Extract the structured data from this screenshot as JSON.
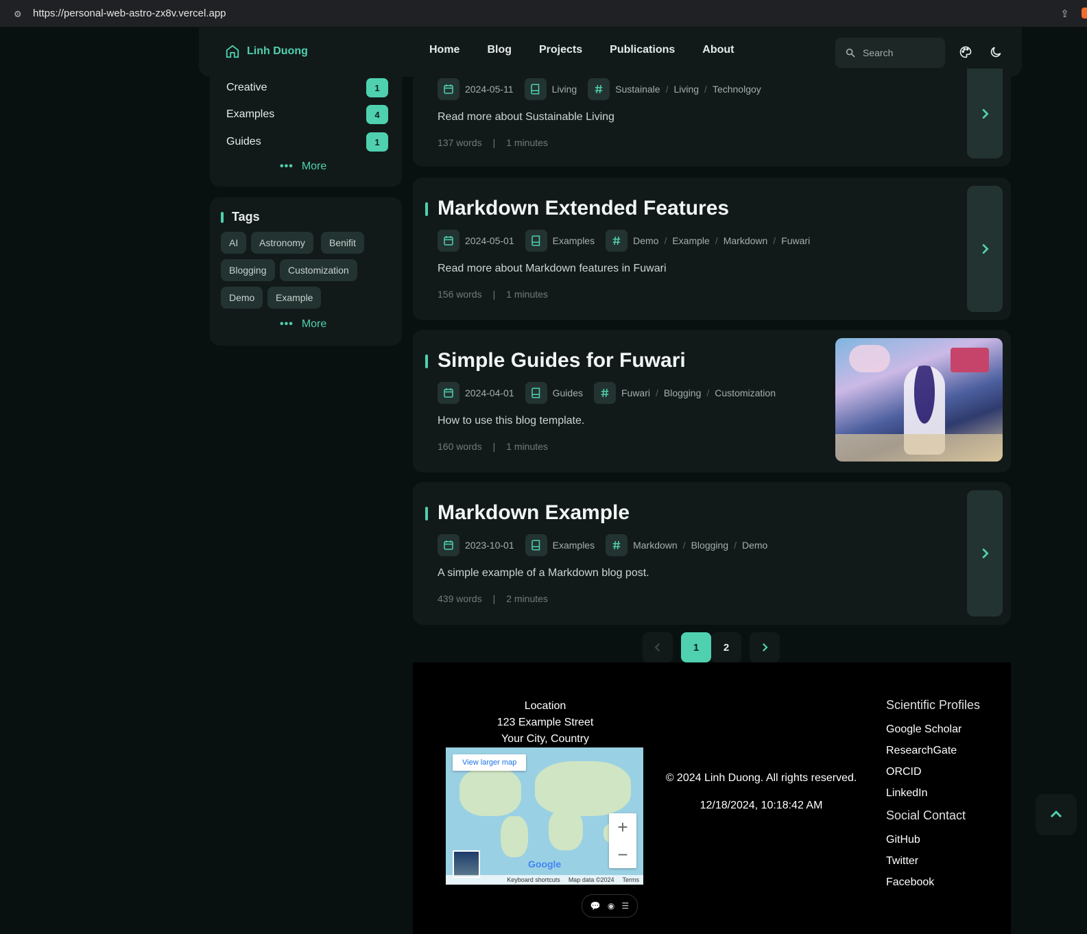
{
  "browser": {
    "url": "https://personal-web-astro-zx8v.vercel.app"
  },
  "nav": {
    "brand": "Linh Duong",
    "links": [
      "Home",
      "Blog",
      "Projects",
      "Publications",
      "About"
    ],
    "search_placeholder": "Search"
  },
  "categories": {
    "items": [
      {
        "name": "Creative",
        "count": "1"
      },
      {
        "name": "Examples",
        "count": "4"
      },
      {
        "name": "Guides",
        "count": "1"
      }
    ],
    "more": "More"
  },
  "tags": {
    "title": "Tags",
    "items": [
      "AI",
      "Astronomy",
      "Benifit",
      "Blogging",
      "Customization",
      "Demo",
      "Example"
    ],
    "more": "More"
  },
  "posts": [
    {
      "title": "",
      "date": "2024-05-11",
      "category": "Living",
      "tags": [
        "Sustainale",
        "Living",
        "Technolgoy"
      ],
      "excerpt": "Read more about Sustainable Living",
      "words": "137 words",
      "minutes": "1 minutes"
    },
    {
      "title": "Markdown Extended Features",
      "date": "2024-05-01",
      "category": "Examples",
      "tags": [
        "Demo",
        "Example",
        "Markdown",
        "Fuwari"
      ],
      "excerpt": "Read more about Markdown features in Fuwari",
      "words": "156 words",
      "minutes": "1 minutes"
    },
    {
      "title": "Simple Guides for Fuwari",
      "date": "2024-04-01",
      "category": "Guides",
      "tags": [
        "Fuwari",
        "Blogging",
        "Customization"
      ],
      "excerpt": "How to use this blog template.",
      "words": "160 words",
      "minutes": "1 minutes"
    },
    {
      "title": "Markdown Example",
      "date": "2023-10-01",
      "category": "Examples",
      "tags": [
        "Markdown",
        "Blogging",
        "Demo"
      ],
      "excerpt": "A simple example of a Markdown blog post.",
      "words": "439 words",
      "minutes": "2 minutes"
    }
  ],
  "pagination": {
    "pages": [
      "1",
      "2"
    ],
    "current": "1"
  },
  "footer": {
    "location_label": "Location",
    "address_line1": "123 Example Street",
    "address_line2": "Your City, Country",
    "map": {
      "view_larger": "View larger map",
      "brand": "Google",
      "keyboard": "Keyboard shortcuts",
      "mapdata": "Map data ©2024",
      "terms": "Terms"
    },
    "copyright": "© 2024 Linh Duong. All rights reserved.",
    "datetime": "12/18/2024, 10:18:42 AM",
    "scientific_title": "Scientific Profiles",
    "scientific_links": [
      "Google Scholar",
      "ResearchGate",
      "ORCID",
      "LinkedIn"
    ],
    "social_title": "Social Contact",
    "social_links": [
      "GitHub",
      "Twitter",
      "Facebook"
    ]
  },
  "colors": {
    "accent": "#4fd1b0",
    "card": "#121a19",
    "page": "#081110",
    "chip": "#233331"
  }
}
